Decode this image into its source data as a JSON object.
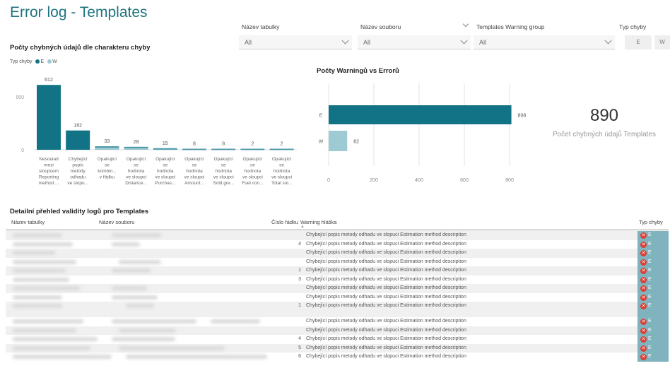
{
  "title": "Error log - Templates",
  "filters": [
    {
      "label": "Název tabulky",
      "value": "All"
    },
    {
      "label": "Název souboru",
      "value": "All"
    },
    {
      "label": "Templates Warning group",
      "value": "All"
    }
  ],
  "typ_filter": {
    "label": "Typ chyby",
    "buttons": [
      "E",
      "W"
    ]
  },
  "chart1": {
    "title": "Počty chybných údajů dle charakteru chyby",
    "legend_label": "Typ chyby",
    "legend_items": [
      "E",
      "W"
    ]
  },
  "chart2": {
    "title": "Počty Warningů vs Errorů"
  },
  "kpi": {
    "value": "890",
    "label": "Počet chybných údajů Templates"
  },
  "chart_data": [
    {
      "type": "bar",
      "categories": [
        [
          "Nesoulad",
          "mezi",
          "sloupcem",
          "Reporting",
          "method ..."
        ],
        [
          "Chybející",
          "popis",
          "metody",
          "odhadu",
          "ve slopu..."
        ],
        [
          "Opakující",
          "se",
          "kombin...",
          "v řádku"
        ],
        [
          "Opakující",
          "se",
          "hodnota",
          "ve sloupci",
          "Distance..."
        ],
        [
          "Opakující",
          "se",
          "hodnota",
          "ve sloupci",
          "Purchas..."
        ],
        [
          "Opakující",
          "se",
          "hodnota",
          "ve sloupci",
          "Amount..."
        ],
        [
          "Opakující",
          "se",
          "hodnota",
          "ve sloupci",
          "Sold gre..."
        ],
        [
          "Opakující",
          "se",
          "hodnota",
          "ve sloupci",
          "Fuel con..."
        ],
        [
          "Opakující",
          "se",
          "hodnota",
          "ve sloupci",
          "Total sol..."
        ]
      ],
      "values": [
        612,
        182,
        33,
        28,
        15,
        8,
        8,
        2,
        2
      ],
      "yticks": [
        0,
        500
      ],
      "ylim": [
        0,
        700
      ],
      "colors": {
        "E": "#127386",
        "W": "#9dcad3"
      }
    },
    {
      "type": "bar",
      "orientation": "horizontal",
      "categories": [
        "E",
        "W"
      ],
      "values": [
        808,
        82
      ],
      "xticks": [
        0,
        200,
        400,
        600,
        800
      ],
      "xlim": [
        0,
        800
      ],
      "colors": [
        "#127386",
        "#9dcad3"
      ]
    }
  ],
  "table": {
    "title": "Detailní přehled validity logů pro Templates",
    "columns": [
      "Název tabulky",
      "Název souboru",
      "Číslo řádku",
      "Warning hláška",
      "Typ chyby"
    ],
    "rows": [
      {
        "row": "",
        "warning": "Chybející popis metody odhadu ve slopuci Estimation method description",
        "type": "E"
      },
      {
        "row": "4",
        "warning": "Chybející popis metody odhadu ve slopuci Estimation method description",
        "type": "E"
      },
      {
        "row": "",
        "warning": "Chybející popis metody odhadu ve slopuci Estimation method description",
        "type": "E"
      },
      {
        "row": "",
        "warning": "Chybející popis metody odhadu ve slopuci Estimation method description",
        "type": "E"
      },
      {
        "row": "1",
        "warning": "Chybející popis metody odhadu ve slopuci Estimation method description",
        "type": "E"
      },
      {
        "row": "3",
        "warning": "Chybející popis metody odhadu ve slopuci Estimation method description",
        "type": "E"
      },
      {
        "row": "",
        "warning": "Chybející popis metody odhadu ve slopuci Estimation method description",
        "type": "E"
      },
      {
        "row": "",
        "warning": "Chybející popis metody odhadu ve slopuci Estimation method description",
        "type": "E"
      },
      {
        "row": "1",
        "warning": "Chybející popis metody odhadu ve slopuci Estimation method description",
        "type": "E"
      },
      {
        "row": "",
        "warning": "Chybející popis metody odhadu ve slopuci Estimation method description",
        "type": "E"
      },
      {
        "row": "",
        "warning": "Chybející popis metody odhadu ve slopuci Estimation method description",
        "type": "E"
      },
      {
        "row": "4",
        "warning": "Chybející popis metody odhadu ve slopuci Estimation method description",
        "type": "E"
      },
      {
        "row": "5",
        "warning": "Chybející popis metody odhadu ve slopuci Estimation method description",
        "type": "E"
      },
      {
        "row": "6",
        "warning": "Chybející popis metody odhadu ve slopuci Estimation method description",
        "type": "E"
      }
    ]
  }
}
